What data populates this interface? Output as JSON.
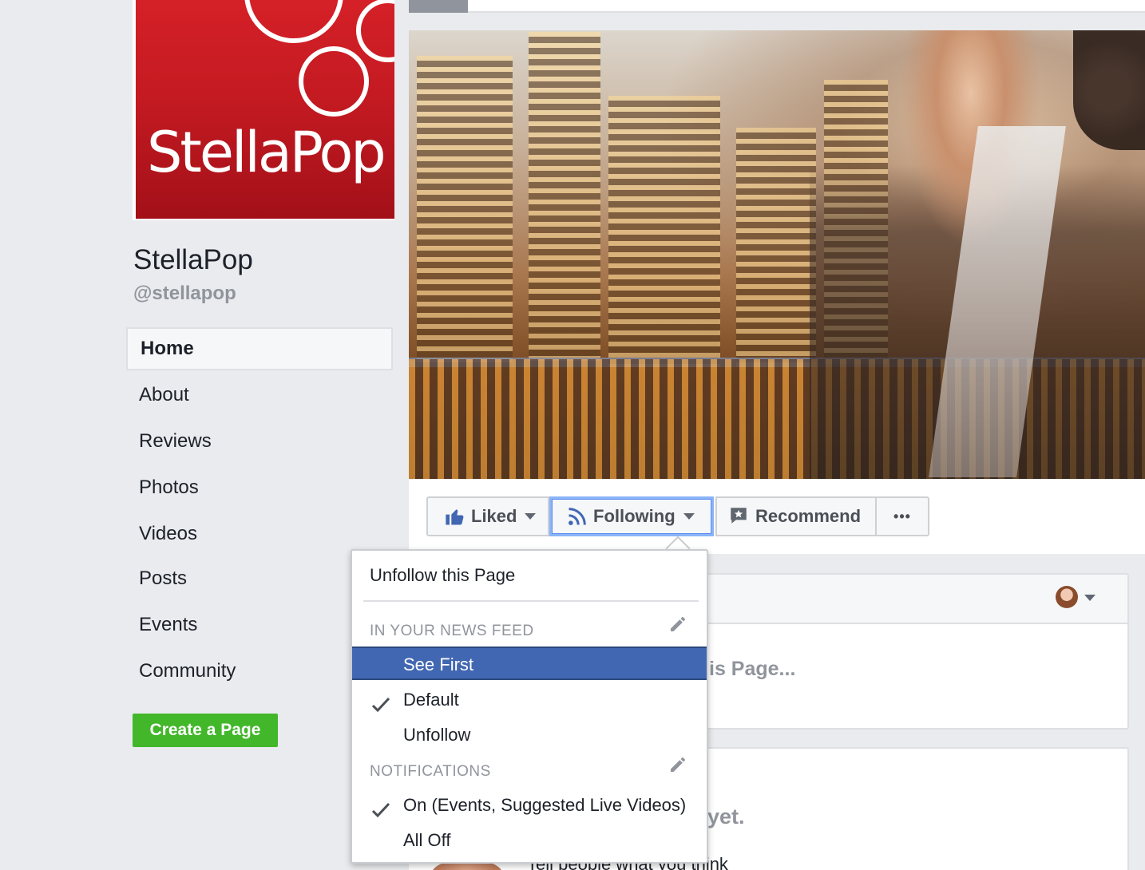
{
  "page": {
    "name": "StellaPop",
    "handle": "@stellapop",
    "logo_text": "StellaPop",
    "brand_color": "#d52027"
  },
  "nav": {
    "items": [
      {
        "label": "Home",
        "active": true
      },
      {
        "label": "About"
      },
      {
        "label": "Reviews"
      },
      {
        "label": "Photos"
      },
      {
        "label": "Videos"
      },
      {
        "label": "Posts"
      },
      {
        "label": "Events"
      },
      {
        "label": "Community"
      }
    ],
    "create_page_label": "Create a Page"
  },
  "actions": {
    "liked_label": "Liked",
    "following_label": "Following",
    "recommend_label": "Recommend",
    "more_label": "•••"
  },
  "dropdown": {
    "unfollow_page": "Unfollow this Page",
    "news_feed_section": "IN YOUR NEWS FEED",
    "news_feed_options": [
      {
        "label": "See First",
        "selected": true
      },
      {
        "label": "Default",
        "checked": true
      },
      {
        "label": "Unfollow"
      }
    ],
    "notifications_section": "NOTIFICATIONS",
    "notification_options": [
      {
        "label": "On (Events, Suggested Live Videos)",
        "checked": true
      },
      {
        "label": "All Off"
      }
    ]
  },
  "feed": {
    "composer_placeholder_partial": "is Page...",
    "reviews_partial": "yet.",
    "reviews_prompt_partial": "Tell people what you think"
  },
  "colors": {
    "accent": "#4267b2",
    "create_button": "#42b72a",
    "focus_ring": "#8ab4f8"
  }
}
